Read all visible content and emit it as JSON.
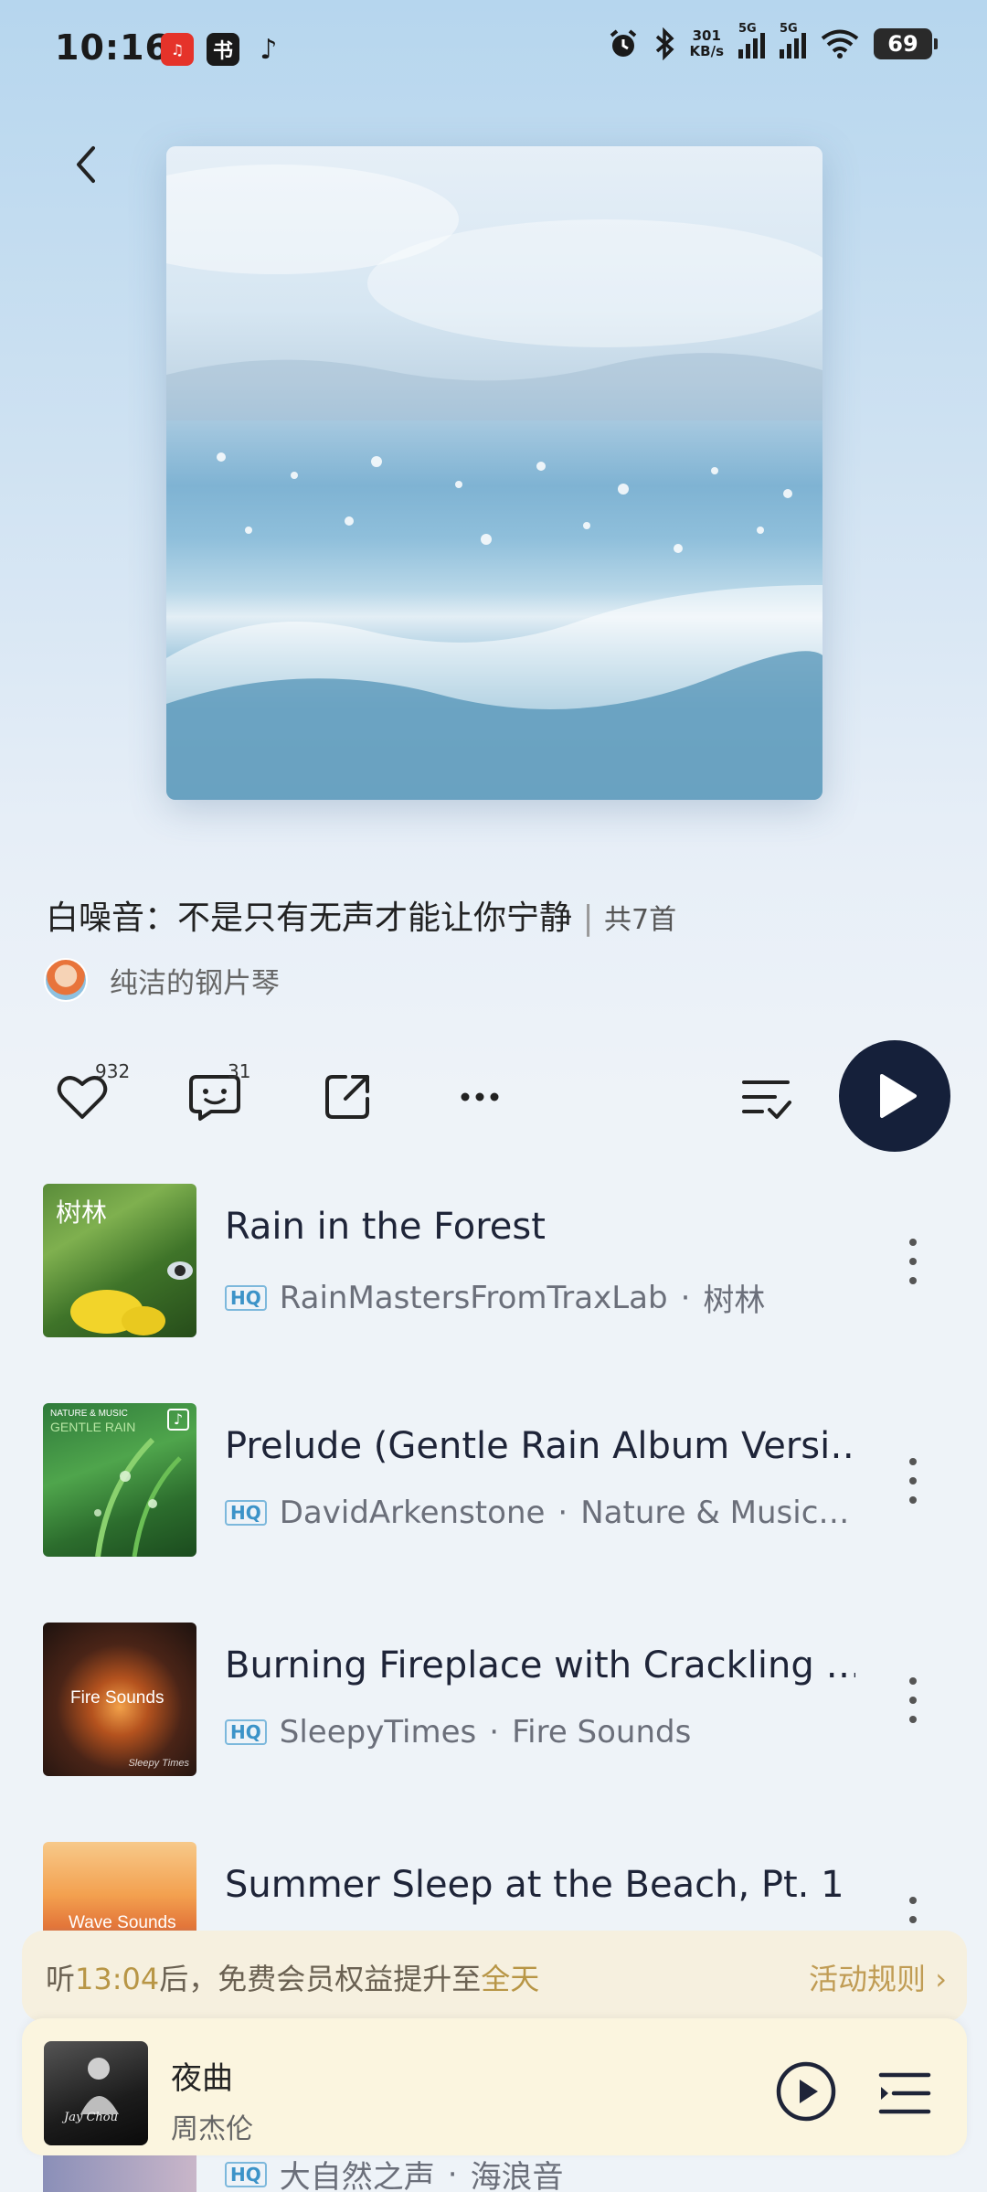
{
  "status_bar": {
    "time": "10:16",
    "net_speed_value": "301",
    "net_speed_unit": "KB/s",
    "signal_1": "5G",
    "signal_2": "5G",
    "battery": "69"
  },
  "playlist": {
    "title": "白噪音：不是只有无声才能让你宁静",
    "count": "共7首",
    "creator": "纯洁的钢片琴"
  },
  "actions": {
    "likes": "932",
    "comments": "31"
  },
  "songs": [
    {
      "title": "Rain in the Forest",
      "artist": "RainMastersFromTraxLab",
      "album": "树林",
      "quality": "HQ",
      "thumb_text": "树林"
    },
    {
      "title": "Prelude (Gentle Rain Album Versi…",
      "artist": "DavidArkenstone",
      "album": "Nature & Music…",
      "quality": "HQ",
      "thumb_text_top": "NATURE & MUSIC",
      "thumb_text": "GENTLE RAIN"
    },
    {
      "title": "Burning Fireplace with Crackling …",
      "artist": "SleepyTimes",
      "album": "Fire Sounds",
      "quality": "HQ",
      "thumb_text": "Fire Sounds",
      "thumb_signature": "Sleepy Times"
    },
    {
      "title": "Summer Sleep at the Beach, Pt. 1",
      "thumb_text": "Wave Sounds"
    },
    {
      "artist": "大自然之声",
      "album": "海浪音",
      "quality": "HQ"
    }
  ],
  "separator": "·",
  "promo": {
    "prefix": "听",
    "time": "13:04",
    "middle": "后，免费会员权益提升至",
    "highlight": "全天",
    "rules": "活动规则 ›"
  },
  "now_playing": {
    "title": "夜曲",
    "artist": "周杰伦",
    "cover_text": "Jay Chou"
  },
  "colors": {
    "play_button": "#15203a",
    "promo_highlight": "#b89646",
    "hq_badge": "#3c93c8"
  }
}
